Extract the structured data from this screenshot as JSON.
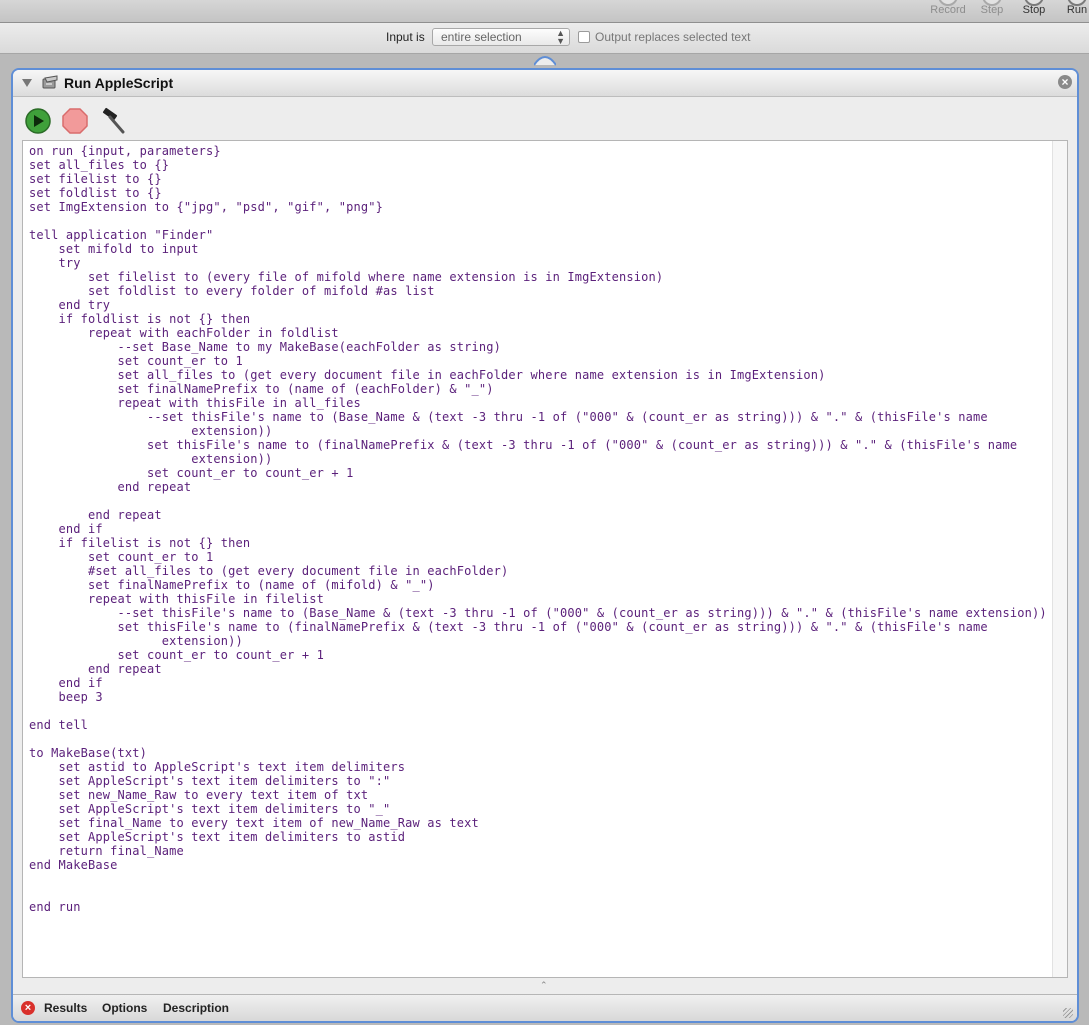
{
  "toolbar": {
    "buttons": [
      {
        "label": "Record",
        "enabled": false
      },
      {
        "label": "Step",
        "enabled": false
      },
      {
        "label": "Stop",
        "enabled": true
      },
      {
        "label": "Run",
        "enabled": true
      }
    ]
  },
  "input_bar": {
    "label": "Input is",
    "select_value": "entire selection",
    "checkbox_label": "Output replaces selected text",
    "checkbox_checked": false
  },
  "action": {
    "title": "Run AppleScript",
    "icons": {
      "disclosure": "disclosure-triangle-icon",
      "script": "applescript-icon",
      "close": "close-icon",
      "run": "run-icon",
      "stop": "stop-icon",
      "compile": "hammer-icon"
    }
  },
  "code": {
    "lines": [
      "on run {input, parameters}",
      "set all_files to {}",
      "set filelist to {}",
      "set foldlist to {}",
      "set ImgExtension to {\"jpg\", \"psd\", \"gif\", \"png\"}",
      "",
      "tell application \"Finder\"",
      "    set mifold to input",
      "    try",
      "        set filelist to (every file of mifold where name extension is in ImgExtension)",
      "        set foldlist to every folder of mifold #as list",
      "    end try",
      "    if foldlist is not {} then",
      "        repeat with eachFolder in foldlist",
      "            --set Base_Name to my MakeBase(eachFolder as string)",
      "            set count_er to 1",
      "            set all_files to (get every document file in eachFolder where name extension is in ImgExtension)",
      "            set finalNamePrefix to (name of (eachFolder) & \"_\")",
      "            repeat with thisFile in all_files",
      "                --set thisFile's name to (Base_Name & (text -3 thru -1 of (\"000\" & (count_er as string))) & \".\" & (thisFile's name",
      "                      extension))",
      "                set thisFile's name to (finalNamePrefix & (text -3 thru -1 of (\"000\" & (count_er as string))) & \".\" & (thisFile's name",
      "                      extension))",
      "                set count_er to count_er + 1",
      "            end repeat",
      "",
      "        end repeat",
      "    end if",
      "    if filelist is not {} then",
      "        set count_er to 1",
      "        #set all_files to (get every document file in eachFolder)",
      "        set finalNamePrefix to (name of (mifold) & \"_\")",
      "        repeat with thisFile in filelist",
      "            --set thisFile's name to (Base_Name & (text -3 thru -1 of (\"000\" & (count_er as string))) & \".\" & (thisFile's name extension))",
      "            set thisFile's name to (finalNamePrefix & (text -3 thru -1 of (\"000\" & (count_er as string))) & \".\" & (thisFile's name",
      "                  extension))",
      "            set count_er to count_er + 1",
      "        end repeat",
      "    end if",
      "    beep 3",
      "",
      "end tell",
      "",
      "to MakeBase(txt)",
      "    set astid to AppleScript's text item delimiters",
      "    set AppleScript's text item delimiters to \":\"",
      "    set new_Name_Raw to every text item of txt",
      "    set AppleScript's text item delimiters to \"_\"",
      "    set final_Name to every text item of new_Name_Raw as text",
      "    set AppleScript's text item delimiters to astid",
      "    return final_Name",
      "end MakeBase",
      "",
      "",
      "end run"
    ]
  },
  "footer": {
    "status_icon": "error-icon",
    "tabs": [
      "Results",
      "Options",
      "Description"
    ]
  },
  "colors": {
    "accent": "#5f8ed6",
    "code_text": "#5a1f7a",
    "error": "#d9302b"
  }
}
